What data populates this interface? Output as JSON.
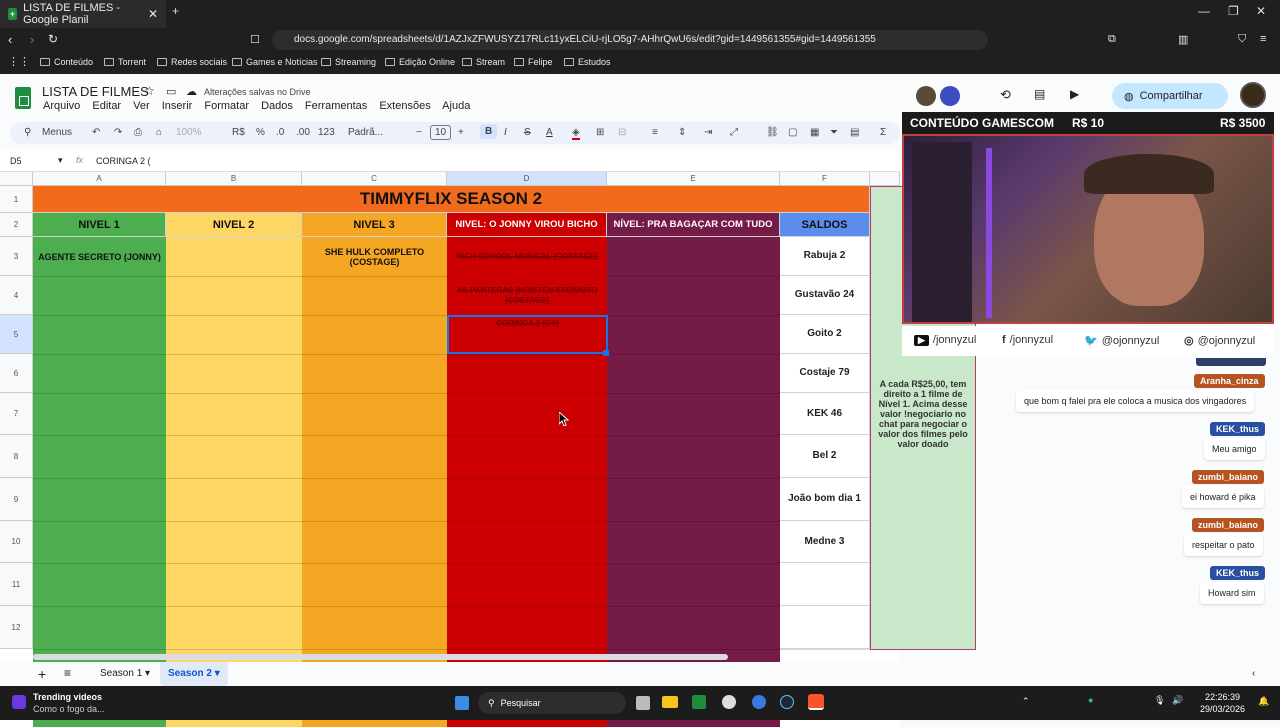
{
  "browser": {
    "tab_title": "LISTA DE FILMES - Google Planil",
    "url": "docs.google.com/spreadsheets/d/1AZJxZFWUSYZ17RLc11yxELCiU-rjLO5g7-AHhrQwU6s/edit?gid=1449561355#gid=1449561355",
    "bookmarks": [
      "Conteúdo",
      "Torrent",
      "Redes sociais",
      "Games e Notícias",
      "Streaming",
      "Edição Online",
      "Stream",
      "Felipe",
      "Estudos"
    ]
  },
  "sheets": {
    "doc_title": "LISTA DE FILMES",
    "save_status": "Alterações salvas no Drive",
    "menus": [
      "Arquivo",
      "Editar",
      "Ver",
      "Inserir",
      "Formatar",
      "Dados",
      "Ferramentas",
      "Extensões",
      "Ajuda"
    ],
    "toolbar": {
      "search": "Menus",
      "zoom": "100%",
      "currency": "R$",
      "percent": "%",
      "dec_less": ".0",
      "dec_more": ".00",
      "number_fmt": "123",
      "font": "Padrã...",
      "font_size": "10",
      "bold": "B",
      "italic": "I"
    },
    "share_label": "Compartilhar",
    "name_box": "D5",
    "formula": "CORINGA 2 (",
    "columns": [
      "A",
      "B",
      "C",
      "D",
      "E",
      "F"
    ],
    "rows": [
      "1",
      "2",
      "3",
      "4",
      "5",
      "6",
      "7",
      "8",
      "9",
      "10",
      "11",
      "12"
    ],
    "title": "TIMMYFLIX SEASON 2",
    "headers": [
      "NIVEL 1",
      "NIVEL 2",
      "NIVEL 3",
      "NIVEL: O JONNY VIROU BICHO",
      "NÍVEL: PRA BAGAÇAR COM TUDO",
      "SALDOS"
    ],
    "a3": "AGENTE SECRETO (JONNY)",
    "c3": "SHE HULK COMPLETO (COSTAGE)",
    "d3": "HIGH SCHOOL MUSICAL (COSTAGE)",
    "d4": "AS PANTERAS (KRISTEN STEWART) (COSTAGE)",
    "d5": "CORINGA 2 (CY)",
    "saldos": [
      "Rabuja 2",
      "Gustavão 24",
      "Goito 2",
      "Costaje 79",
      "KEK 46",
      "Bel 2",
      "João bom dia 1",
      "Medne 3",
      "",
      ""
    ],
    "sheet_tabs": [
      "Season 1",
      "Season 2"
    ]
  },
  "overlay": {
    "banner": "CONTEÚDO GAMESCOM",
    "price1": "R$ 10",
    "price2": "R$ 3500",
    "socials": [
      "/jonnyzul",
      "/jonnyzul",
      "@ojonnyzul",
      "@ojonnyzul"
    ],
    "note": "A cada R$25,00, tem direito a 1 filme de Nível 1. Acima desse valor !negociario no chat para negociar o valor dos filmes pelo valor doado",
    "chat": [
      {
        "user": "Aranha_cinza",
        "msg": "que bom q falei pra ele coloca a musica dos vingadores"
      },
      {
        "user": "KEK_thus",
        "msg": "Meu amigo"
      },
      {
        "user": "zumbi_baiano",
        "msg": "ei howard é pika"
      },
      {
        "user": "zumbi_baiano",
        "msg": "respeitar o pato"
      },
      {
        "user": "KEK_thus",
        "msg": "Howard sim"
      }
    ]
  },
  "taskbar": {
    "widget_title": "Trending videos",
    "widget_sub": "Como o fogo da...",
    "search": "Pesquisar",
    "time": "22:26:39",
    "date": "29/03/2026"
  },
  "colors": {
    "green": "#4cae4f",
    "yellow": "#fdd663",
    "orange": "#f5a623",
    "red": "#cc0000",
    "purple": "#741b47",
    "blue": "#5b8def",
    "title_orange": "#f26b1d"
  }
}
